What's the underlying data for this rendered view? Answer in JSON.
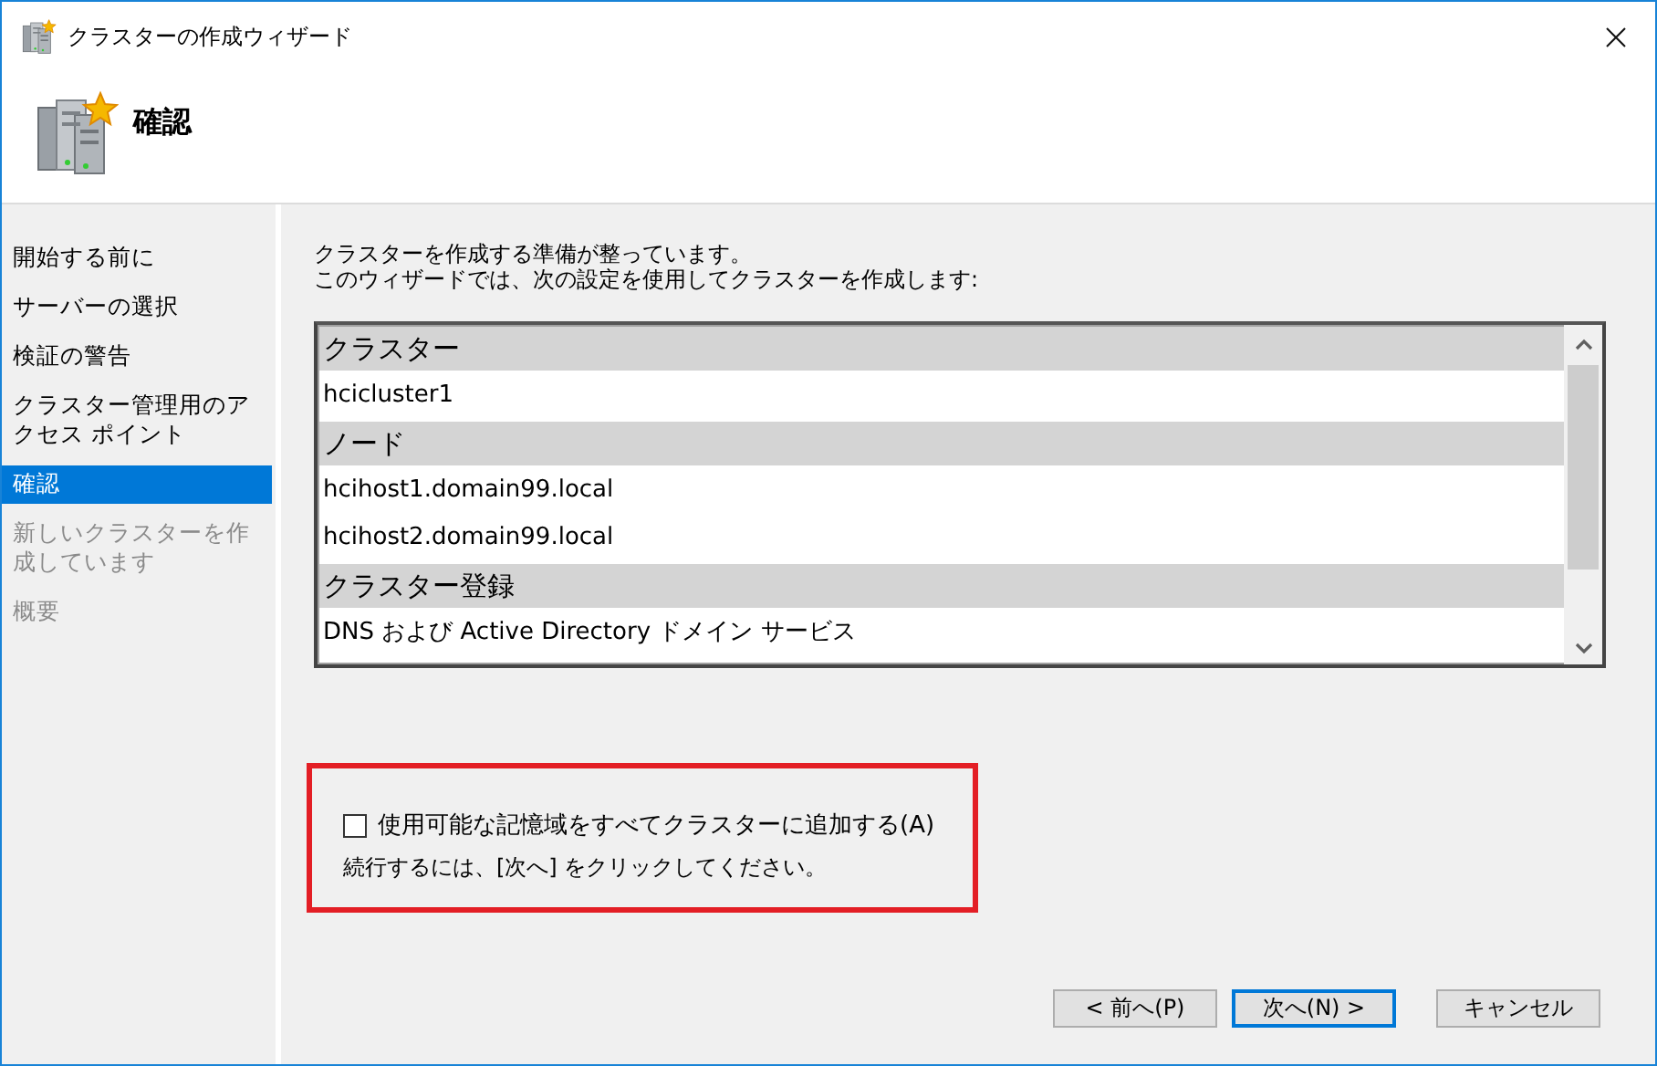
{
  "window": {
    "title": "クラスターの作成ウィザード"
  },
  "header": {
    "title": "確認"
  },
  "steps": [
    {
      "label": "開始する前に",
      "selected": false,
      "disabled": false
    },
    {
      "label": "サーバーの選択",
      "selected": false,
      "disabled": false
    },
    {
      "label": "検証の警告",
      "selected": false,
      "disabled": false
    },
    {
      "label": "クラスター管理用のアクセス ポイント",
      "selected": false,
      "disabled": false
    },
    {
      "label": "確認",
      "selected": true,
      "disabled": false
    },
    {
      "label": "新しいクラスターを作成しています",
      "selected": false,
      "disabled": true
    },
    {
      "label": "概要",
      "selected": false,
      "disabled": true
    }
  ],
  "intro": [
    "クラスターを作成する準備が整っています。",
    "このウィザードでは、次の設定を使用してクラスターを作成します:"
  ],
  "summary": [
    {
      "kind": "heading",
      "text": "クラスター"
    },
    {
      "kind": "item",
      "text": "hcicluster1"
    },
    {
      "kind": "heading",
      "text": "ノード"
    },
    {
      "kind": "item",
      "text": "hcihost1.domain99.local"
    },
    {
      "kind": "item",
      "text": "hcihost2.domain99.local"
    },
    {
      "kind": "heading",
      "text": "クラスター登録"
    },
    {
      "kind": "item",
      "text": "DNS および Active Directory ドメイン サービス"
    }
  ],
  "add_storage": {
    "label": "使用可能な記憶域をすべてクラスターに追加する(A)",
    "checked": false
  },
  "hint": "続行するには、[次へ] をクリックしてください。",
  "buttons": [
    {
      "label": "< 前へ(P)",
      "focused": false
    },
    {
      "label": "次へ(N) >",
      "focused": true
    },
    {
      "label": "キャンセル",
      "focused": false
    }
  ]
}
